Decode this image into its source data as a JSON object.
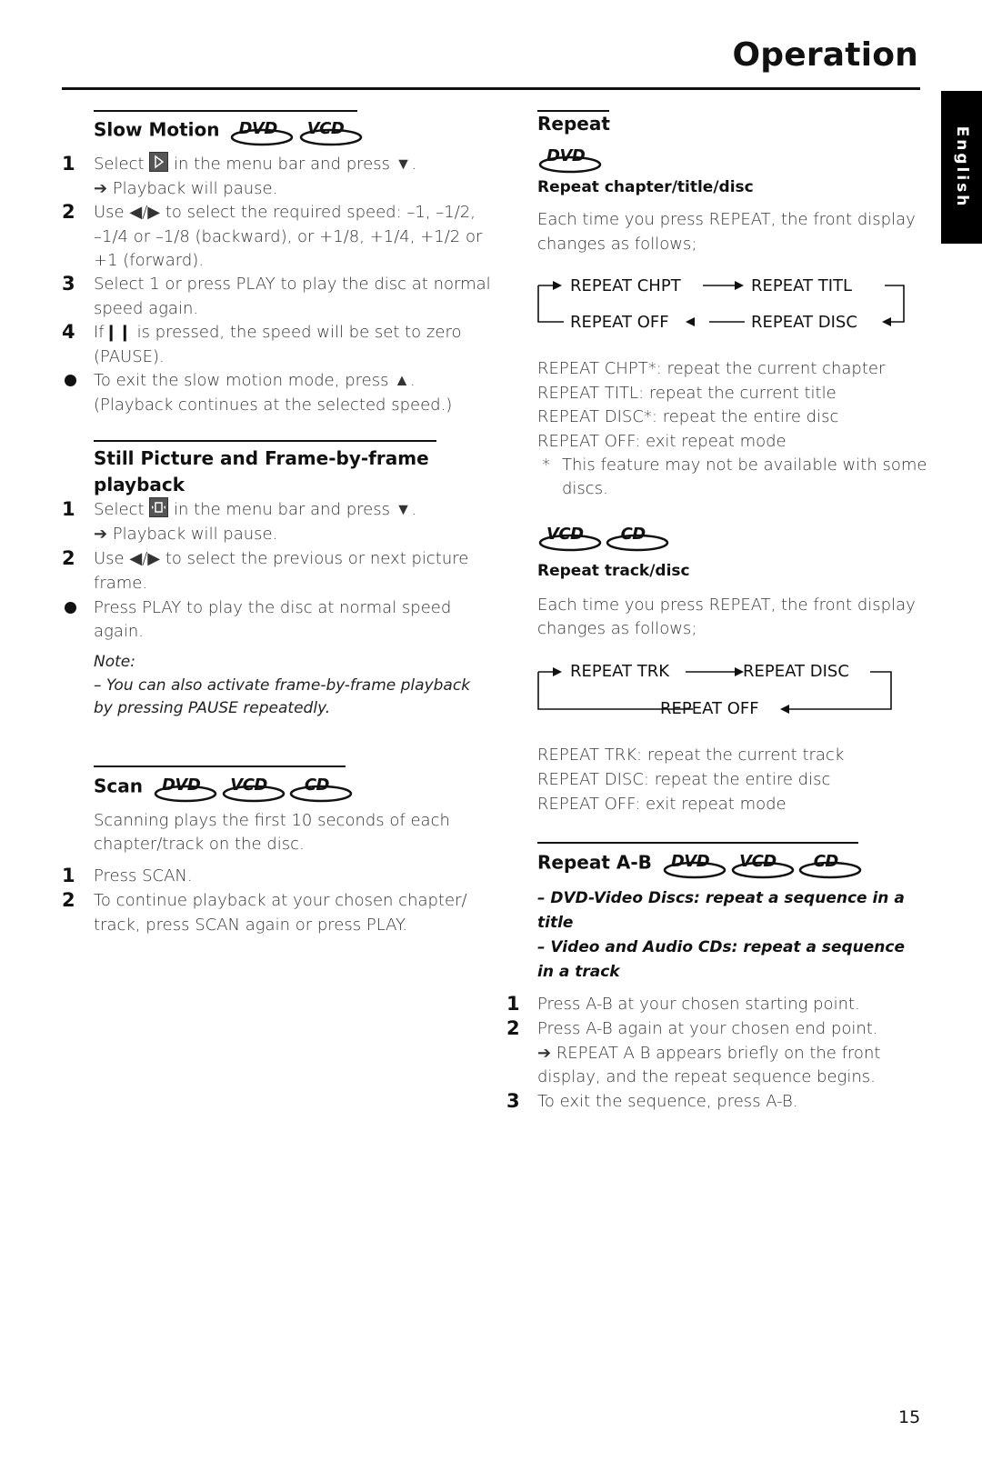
{
  "header": {
    "title": "Operation",
    "language_tab": "English"
  },
  "left_column": {
    "slow_motion": {
      "title": "Slow Motion",
      "discs": [
        "DVD",
        "VCD"
      ],
      "steps": [
        {
          "marker": "1",
          "lines": [
            "in the menu bar and press ▼.",
            "➔  Playback will pause."
          ],
          "prefix": "Select"
        },
        {
          "marker": "2",
          "lines": [
            "Use ◀/▶ to select the required speed: –1, –1/2,",
            "–1/4 or –1/8 (backward), or +1/8, +1/4, +1/2 or",
            "+1 (forward)."
          ]
        },
        {
          "marker": "3",
          "lines": [
            "Select 1 or press PLAY to play the disc at normal",
            "speed again."
          ]
        },
        {
          "marker": "4",
          "prefix": "If",
          "lines": [
            "is pressed, the speed will be set to zero",
            "(PAUSE)."
          ]
        },
        {
          "marker": "bullet",
          "lines": [
            "To exit the slow motion mode, press ▲.",
            "(Playback continues at the selected speed.)"
          ]
        }
      ]
    },
    "still_picture": {
      "title_line1": "Still Picture and Frame-by-frame",
      "title_line2": "playback",
      "steps": [
        {
          "marker": "1",
          "prefix": "Select",
          "lines": [
            "in the menu bar and press ▼.",
            "➔  Playback will pause."
          ]
        },
        {
          "marker": "2",
          "lines": [
            "Use ◀/▶ to select the previous or next picture",
            "frame."
          ]
        },
        {
          "marker": "bullet",
          "lines": [
            "Press PLAY to play the disc at normal speed",
            "again."
          ]
        }
      ],
      "note_label": "Note:",
      "note_lines": [
        "–   You can also activate frame-by-frame playback",
        "by pressing PAUSE repeatedly."
      ]
    },
    "scan": {
      "title": "Scan",
      "discs": [
        "DVD",
        "VCD",
        "CD"
      ],
      "intro": [
        "Scanning plays the first 10 seconds of each",
        "chapter/track on the disc."
      ],
      "steps": [
        {
          "marker": "1",
          "lines": [
            "Press SCAN."
          ]
        },
        {
          "marker": "2",
          "lines": [
            "To continue playback at your chosen chapter/",
            "track, press SCAN again or press PLAY."
          ]
        }
      ]
    }
  },
  "right_column": {
    "repeat": {
      "title": "Repeat",
      "dvd_disc": "DVD",
      "subtitle_dvd": "Repeat chapter/title/disc",
      "intro_dvd": [
        "Each time you press REPEAT, the front display",
        "changes as follows;"
      ],
      "diagram_dvd": {
        "a": "REPEAT CHPT",
        "b": "REPEAT TITL",
        "c": "REPEAT DISC",
        "d": "REPEAT OFF"
      },
      "legend_dvd": [
        "REPEAT CHPT*: repeat the current chapter",
        "REPEAT TITL: repeat the current title",
        "REPEAT DISC*: repeat the entire disc",
        "REPEAT OFF: exit repeat mode"
      ],
      "footnote_mark": "*",
      "footnote_lines": [
        "This feature may not be available with some",
        "discs."
      ],
      "vcd_discs": [
        "VCD",
        "CD"
      ],
      "subtitle_vcd": "Repeat track/disc",
      "intro_vcd": [
        "Each time you press REPEAT, the front display",
        "changes as follows;"
      ],
      "diagram_vcd": {
        "a": "REPEAT TRK",
        "b": "REPEAT DISC",
        "c": "REPEAT OFF"
      },
      "legend_vcd": [
        "REPEAT TRK: repeat the current track",
        "REPEAT DISC: repeat the entire disc",
        "REPEAT OFF: exit repeat mode"
      ]
    },
    "repeat_ab": {
      "title": "Repeat A-B",
      "discs": [
        "DVD",
        "VCD",
        "CD"
      ],
      "notes": [
        [
          "–   DVD-Video Discs: repeat a sequence in a",
          "title"
        ],
        [
          "–   Video and Audio CDs: repeat a sequence",
          "in a track"
        ]
      ],
      "steps": [
        {
          "marker": "1",
          "lines": [
            "Press A-B at your chosen starting point."
          ]
        },
        {
          "marker": "2",
          "lines": [
            "Press A-B again at your chosen end point.",
            "➔  REPEAT A B appears briefly on the front",
            "display, and the repeat sequence begins."
          ]
        },
        {
          "marker": "3",
          "lines": [
            "To exit the sequence, press A-B."
          ]
        }
      ]
    }
  },
  "footer": {
    "page_number": "15"
  }
}
